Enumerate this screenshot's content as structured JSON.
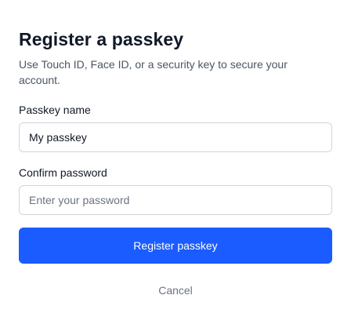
{
  "dialog": {
    "title": "Register a passkey",
    "description": "Use Touch ID, Face ID, or a security key to secure your account."
  },
  "passkey_name": {
    "label": "Passkey name",
    "value": "My passkey",
    "placeholder": ""
  },
  "confirm_password": {
    "label": "Confirm password",
    "value": "",
    "placeholder": "Enter your password"
  },
  "actions": {
    "register_label": "Register passkey",
    "cancel_label": "Cancel"
  },
  "colors": {
    "primary": "#1a5cff",
    "title_text": "#111827",
    "muted_text": "#6b7280"
  }
}
